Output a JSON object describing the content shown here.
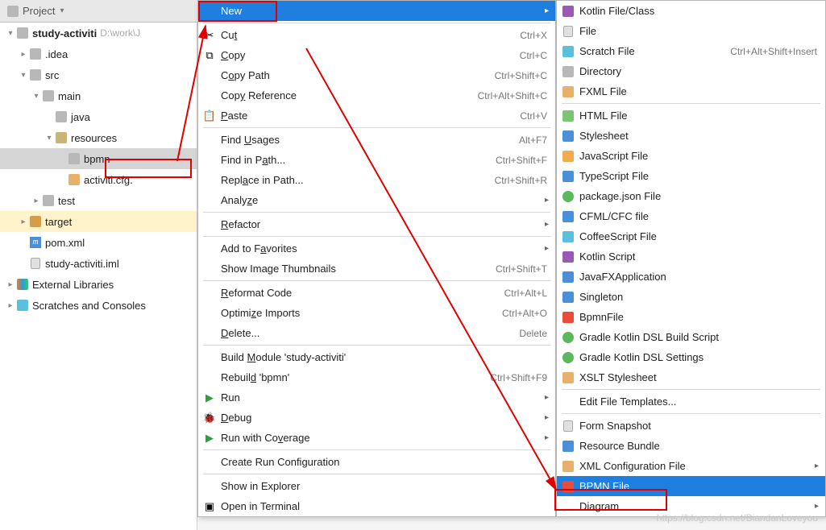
{
  "top_bar": {
    "title": "Project"
  },
  "tree": {
    "root": {
      "label": "study-activiti",
      "path": "D:\\work\\J"
    },
    "idea": ".idea",
    "src": "src",
    "main": "main",
    "java": "java",
    "resources": "resources",
    "bpmn": "bpmn",
    "activiti_cfg": "activiti.cfg.",
    "test": "test",
    "target": "target",
    "pom": "pom.xml",
    "iml": "study-activiti.iml",
    "ext_lib": "External Libraries",
    "scratches": "Scratches and Consoles"
  },
  "context_menu": {
    "new": "New",
    "cut": "Cut",
    "cut_sc": "Ctrl+X",
    "copy": "Copy",
    "copy_sc": "Ctrl+C",
    "copy_path": "Copy Path",
    "copy_path_sc": "Ctrl+Shift+C",
    "copy_ref": "Copy Reference",
    "copy_ref_sc": "Ctrl+Alt+Shift+C",
    "paste": "Paste",
    "paste_sc": "Ctrl+V",
    "find_usages": "Find Usages",
    "find_usages_sc": "Alt+F7",
    "find_in_path": "Find in Path...",
    "find_in_path_sc": "Ctrl+Shift+F",
    "replace_in_path": "Replace in Path...",
    "replace_in_path_sc": "Ctrl+Shift+R",
    "analyze": "Analyze",
    "refactor": "Refactor",
    "add_fav": "Add to Favorites",
    "show_thumb": "Show Image Thumbnails",
    "show_thumb_sc": "Ctrl+Shift+T",
    "reformat": "Reformat Code",
    "reformat_sc": "Ctrl+Alt+L",
    "optimize": "Optimize Imports",
    "optimize_sc": "Ctrl+Alt+O",
    "delete": "Delete...",
    "delete_sc": "Delete",
    "build_module": "Build Module 'study-activiti'",
    "rebuild": "Rebuild 'bpmn'",
    "rebuild_sc": "Ctrl+Shift+F9",
    "run": "Run",
    "debug": "Debug",
    "run_cov": "Run with Coverage",
    "create_run": "Create Run Configuration",
    "show_explorer": "Show in Explorer",
    "open_terminal": "Open in Terminal"
  },
  "submenu": {
    "kotlin_class": "Kotlin File/Class",
    "file": "File",
    "scratch": "Scratch File",
    "scratch_sc": "Ctrl+Alt+Shift+Insert",
    "directory": "Directory",
    "fxml": "FXML File",
    "html": "HTML File",
    "stylesheet": "Stylesheet",
    "javascript": "JavaScript File",
    "typescript": "TypeScript File",
    "package_json": "package.json File",
    "cfml": "CFML/CFC file",
    "coffee": "CoffeeScript File",
    "kotlin_script": "Kotlin Script",
    "javafx": "JavaFXApplication",
    "singleton": "Singleton",
    "bpmnfile": "BpmnFile",
    "gradle_build": "Gradle Kotlin DSL Build Script",
    "gradle_settings": "Gradle Kotlin DSL Settings",
    "xslt": "XSLT Stylesheet",
    "edit_templates": "Edit File Templates...",
    "form_snapshot": "Form Snapshot",
    "resource_bundle": "Resource Bundle",
    "xml_config": "XML Configuration File",
    "bpmn_file": "BPMN File",
    "diagram": "Diagram"
  },
  "watermark": "https://blog.csdn.net/BiandanLoveyou"
}
